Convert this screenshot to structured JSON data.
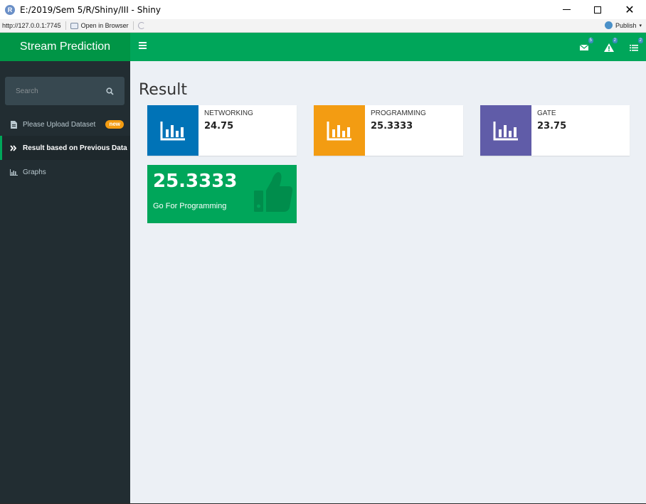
{
  "window": {
    "title": "E:/2019/Sem 5/R/Shiny/III - Shiny",
    "logo_letter": "R",
    "close_glyph": "✕"
  },
  "toolbar": {
    "url": "http://127.0.0.1:7745",
    "open_in_browser": "Open in Browser",
    "publish": "Publish",
    "publish_caret": "▾"
  },
  "header": {
    "app_title": "Stream Prediction",
    "notifications": [
      {
        "icon": "envelope-icon",
        "count": "5"
      },
      {
        "icon": "warning-icon",
        "count": "2"
      },
      {
        "icon": "tasks-icon",
        "count": "2"
      }
    ]
  },
  "sidebar": {
    "search_placeholder": "Search",
    "items": [
      {
        "label": "Please Upload Dataset",
        "icon": "file-icon",
        "badge": "new"
      },
      {
        "label": "Result based on Previous Data",
        "icon": "double-chevron-right-icon"
      },
      {
        "label": "Graphs",
        "icon": "bar-chart-icon"
      }
    ]
  },
  "main": {
    "title": "Result",
    "info_boxes": [
      {
        "label": "NETWORKING",
        "value": "24.75",
        "color": "#0073b7",
        "icon": "bar-chart-icon"
      },
      {
        "label": "PROGRAMMING",
        "value": "25.3333",
        "color": "#f39c12",
        "icon": "bar-chart-icon"
      },
      {
        "label": "GATE",
        "value": "23.75",
        "color": "#605ca8",
        "icon": "bar-chart-icon"
      }
    ],
    "value_box": {
      "value": "25.3333",
      "subtitle": "Go For Programming",
      "color": "#00a65a",
      "icon": "thumbs-up-icon"
    }
  },
  "colors": {
    "logo_bg": "#009546",
    "navbar_bg": "#00a65a",
    "sidebar_bg": "#222d32",
    "content_bg": "#ecf0f5"
  }
}
